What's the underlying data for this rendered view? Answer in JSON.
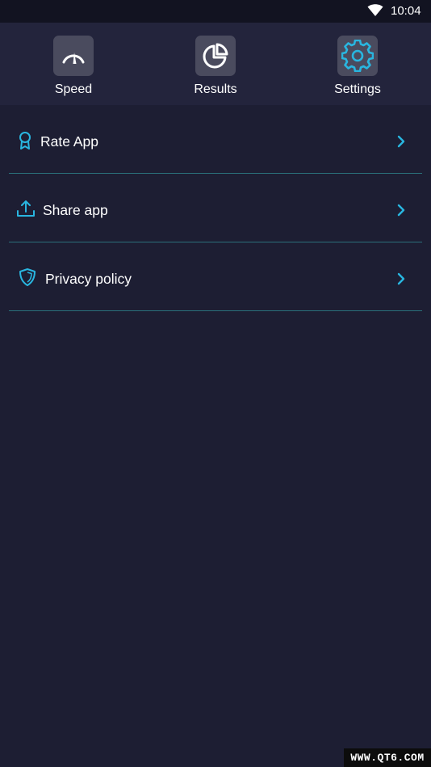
{
  "status_bar": {
    "time": "10:04",
    "wifi_icon": "wifi-icon"
  },
  "nav": {
    "tabs": [
      {
        "label": "Speed",
        "icon": "speedometer-icon",
        "active": false
      },
      {
        "label": "Results",
        "icon": "pie-chart-icon",
        "active": false
      },
      {
        "label": "Settings",
        "icon": "gear-icon",
        "active": true
      }
    ]
  },
  "menu": {
    "items": [
      {
        "label": "Rate App",
        "icon": "ribbon-award-icon"
      },
      {
        "label": "Share app",
        "icon": "upload-share-icon"
      },
      {
        "label": "Privacy policy",
        "icon": "shield-icon"
      }
    ]
  },
  "watermark": "WWW.QT6.COM",
  "colors": {
    "background": "#1d1e33",
    "nav_background": "#23243c",
    "status_bar": "#121321",
    "accent": "#29b6e0",
    "tile": "#4a4b5e",
    "divider": "#2a6f7a"
  }
}
